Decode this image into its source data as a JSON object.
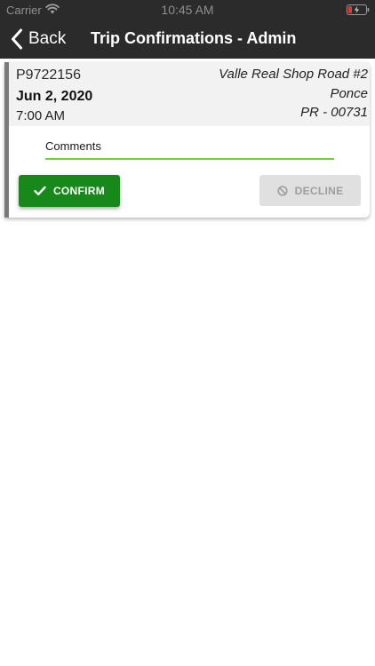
{
  "status_bar": {
    "carrier": "Carrier",
    "time": "10:45 AM",
    "wifi_icon": "wifi-icon",
    "battery_icon": "battery-low-charging-icon"
  },
  "nav": {
    "back_label": "Back",
    "back_icon": "chevron-left-icon",
    "title": "Trip Confirmations - Admin"
  },
  "trip": {
    "id": "P9722156",
    "date": "Jun 2, 2020",
    "time": "7:00 AM",
    "address": {
      "line1": "Valle Real Shop Road #2",
      "line2": "Ponce",
      "line3": "PR - 00731"
    },
    "comments": {
      "label": "Comments",
      "value": ""
    },
    "confirm": {
      "label": "CONFIRM",
      "icon": "check-icon",
      "color": "#16891a"
    },
    "decline": {
      "label": "DECLINE",
      "icon": "block-icon",
      "disabled": true
    }
  },
  "colors": {
    "nav_background": "#2b2b2b",
    "card_accent": "#7a7a7a",
    "comments_underline": "#71d23a"
  }
}
